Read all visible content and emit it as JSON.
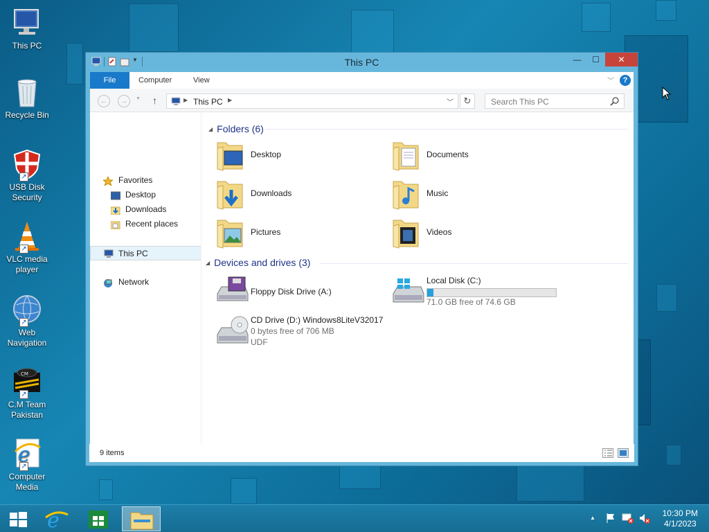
{
  "desktop": {
    "icons": [
      {
        "label": "This PC",
        "icon": "computer-icon",
        "shortcut": false
      },
      {
        "label": "Recycle Bin",
        "icon": "recycle-bin-icon",
        "shortcut": false
      },
      {
        "label": "USB Disk Security",
        "icon": "shield-icon",
        "shortcut": true
      },
      {
        "label": "VLC media player",
        "icon": "vlc-cone-icon",
        "shortcut": true
      },
      {
        "label": "Web Navigation",
        "icon": "globe-icon",
        "shortcut": true
      },
      {
        "label": "C.M Team Pakistan",
        "icon": "cm-team-icon",
        "shortcut": true
      },
      {
        "label": "Computer Media",
        "icon": "internet-explorer-icon",
        "shortcut": true
      }
    ]
  },
  "window": {
    "title": "This PC",
    "controls": {
      "minimize": "—",
      "maximize": "☐",
      "close": "✕"
    },
    "ribbon": {
      "tabs": [
        "File",
        "Computer",
        "View"
      ],
      "help": "?"
    },
    "address": {
      "path": "This PC"
    },
    "search": {
      "placeholder": "Search This PC"
    },
    "nav": {
      "favorites_label": "Favorites",
      "favorites": [
        "Desktop",
        "Downloads",
        "Recent places"
      ],
      "this_pc": "This PC",
      "network": "Network"
    },
    "folders": {
      "heading": "Folders (6)",
      "items": [
        "Desktop",
        "Documents",
        "Downloads",
        "Music",
        "Pictures",
        "Videos"
      ]
    },
    "devices": {
      "heading": "Devices and drives (3)",
      "floppy": {
        "label": "Floppy Disk Drive (A:)"
      },
      "local": {
        "label": "Local Disk (C:)",
        "free": "71.0 GB free of 74.6 GB",
        "used_fraction": 0.048
      },
      "cd": {
        "label": "CD Drive (D:) Windows8LiteV32017",
        "free": "0 bytes free of 706 MB",
        "fs": "UDF"
      }
    },
    "status": {
      "count": "9 items"
    }
  },
  "taskbar": {
    "clock_time": "10:30 PM",
    "clock_date": "4/1/2023"
  },
  "colors": {
    "accent": "#1979ca",
    "window_frame": "#67b7dc",
    "close": "#c7443a"
  }
}
